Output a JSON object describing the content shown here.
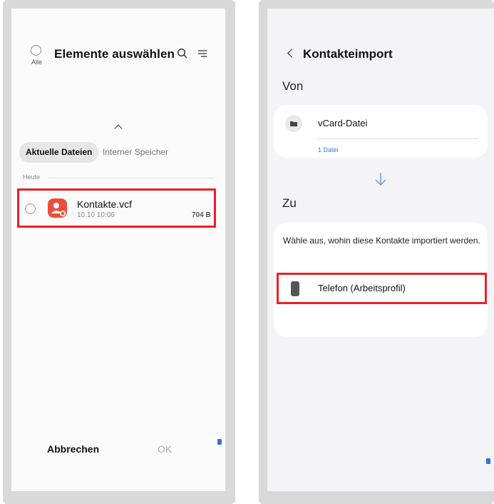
{
  "left": {
    "select_all_label": "Alle",
    "title": "Elemente auswählen",
    "icons": {
      "search": "search-icon",
      "sort": "sort-icon",
      "collapse": "chevron-up-icon"
    },
    "tabs": [
      {
        "label": "Aktuelle Dateien",
        "active": true
      },
      {
        "label": "Interner Speicher",
        "active": false
      }
    ],
    "section_label": "Heute",
    "file": {
      "name": "Kontakte.vcf",
      "date": "10.10 10:06",
      "size": "704 B"
    },
    "footer": {
      "cancel_label": "Abbrechen",
      "ok_label": "OK"
    }
  },
  "right": {
    "title": "Kontakteimport",
    "from_label": "Von",
    "source": {
      "name": "vCard-Datei",
      "detail": "1 Datei"
    },
    "to_label": "Zu",
    "description": "Wähle aus, wohin diese Kontakte importiert werden.",
    "destination": {
      "name": "Telefon (Arbeitsprofil)"
    }
  },
  "colors": {
    "highlight": "#e8202a",
    "accent_blue": "#3d7bd6",
    "file_icon": "#ea4f3c"
  }
}
